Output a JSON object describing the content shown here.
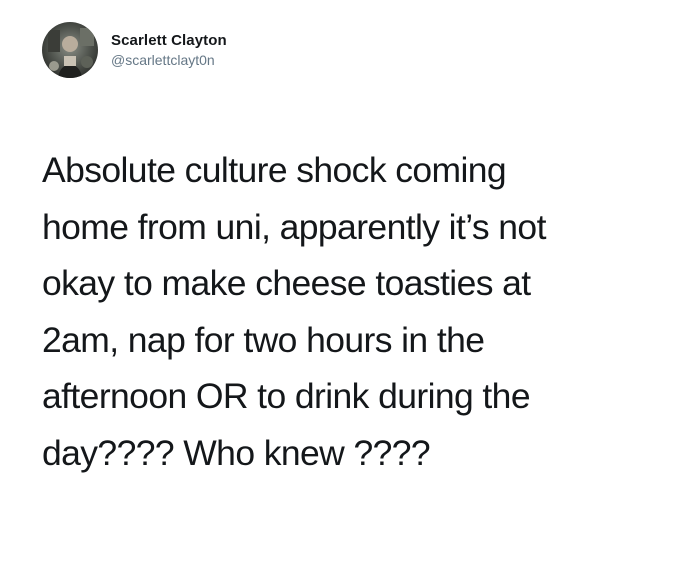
{
  "tweet": {
    "author": {
      "display_name": "Scarlett Clayton",
      "handle": "@scarlettclayt0n",
      "avatar_icon": "profile-photo"
    },
    "text_lines": [
      "Absolute culture shock coming",
      "home from uni, apparently it’s not",
      "okay to make cheese toasties at",
      "2am, nap for two hours in the",
      "afternoon OR to drink during the",
      "day???? Who knew ????"
    ]
  },
  "colors": {
    "background": "#ffffff",
    "text": "#14171a",
    "handle": "#657786"
  }
}
